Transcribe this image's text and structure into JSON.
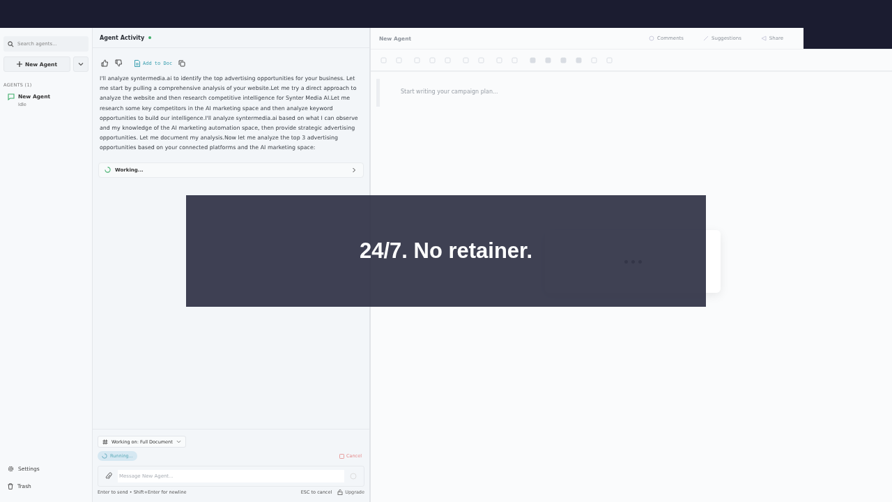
{
  "sidebar": {
    "search": {
      "placeholder": "Search agents..."
    },
    "new_button": "New Agent",
    "section_label": "AGENTS (1)",
    "agents": [
      {
        "name": "New Agent",
        "status": "Idle"
      }
    ],
    "footer_items": [
      {
        "kind": "settings",
        "label": "Settings"
      },
      {
        "kind": "trash",
        "label": "Trash"
      }
    ]
  },
  "chat": {
    "title": "Agent Activity",
    "add_to_doc": "Add to Doc",
    "message": "I'll analyze syntermedia.ai to identify the top advertising opportunities for your business. Let me start by pulling a comprehensive analysis of your website.Let me try a direct approach to analyze the website and then research competitive intelligence for Synter Media AI.Let me research some key competitors in the AI marketing space and then analyze keyword opportunities to build our intelligence.I'll analyze syntermedia.ai based on what I can observe and my knowledge of the AI marketing automation space, then provide strategic advertising opportunities. Let me document my analysis.Now let me analyze the top 3 advertising opportunities based on your connected platforms and the AI marketing space:",
    "working": "Working...",
    "context": "Working on: Full Document",
    "status": "Running...",
    "cancel": "Cancel",
    "input": {
      "placeholder": "Message New Agent..."
    },
    "hint": "Enter to send • Shift+Enter for newline",
    "esc_hint": "ESC to cancel",
    "upgrade": "Upgrade"
  },
  "editor": {
    "title": "New Agent",
    "header_actions": [
      {
        "kind": "comment",
        "label": "Comments"
      },
      {
        "kind": "suggest",
        "label": "Suggestions"
      },
      {
        "kind": "share",
        "label": "Share"
      }
    ],
    "placeholder": "Start writing your campaign plan..."
  },
  "caption": "24/7. No retainer."
}
